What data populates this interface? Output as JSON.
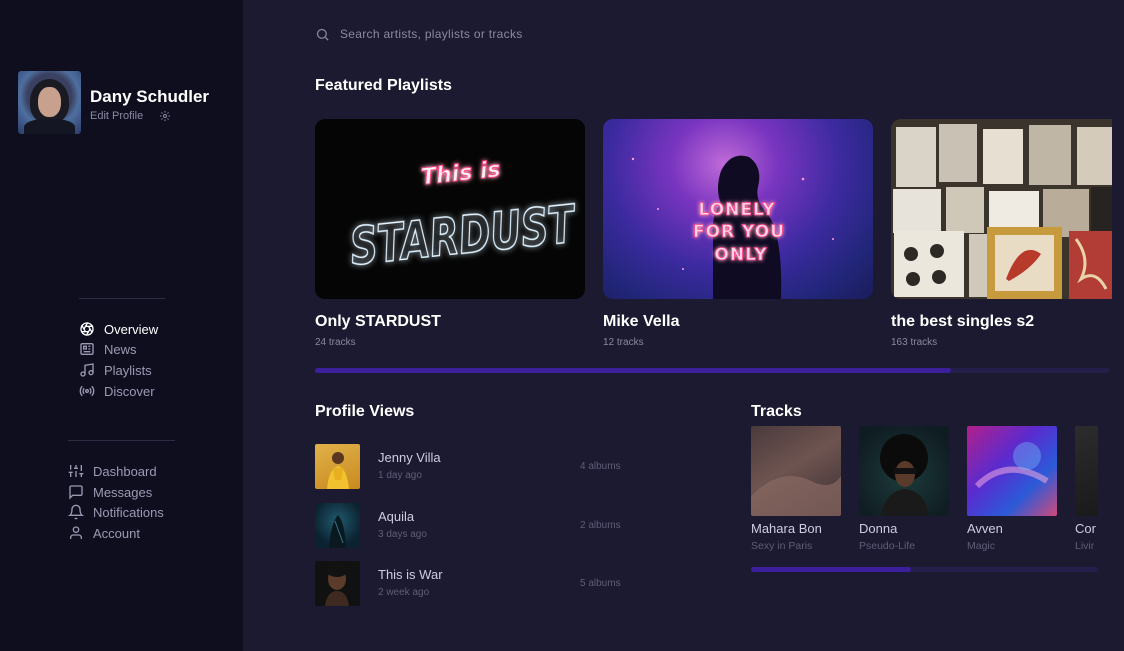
{
  "profile": {
    "name": "Dany Schudler",
    "edit_label": "Edit Profile"
  },
  "nav_primary": [
    {
      "label": "Overview",
      "icon": "aperture-icon",
      "active": true
    },
    {
      "label": "News",
      "icon": "newspaper-icon"
    },
    {
      "label": "Playlists",
      "icon": "music-note-icon"
    },
    {
      "label": "Discover",
      "icon": "radio-icon"
    }
  ],
  "nav_secondary": [
    {
      "label": "Dashboard",
      "icon": "sliders-icon"
    },
    {
      "label": "Messages",
      "icon": "chat-icon"
    },
    {
      "label": "Notifications",
      "icon": "bell-icon"
    },
    {
      "label": "Account",
      "icon": "user-icon"
    }
  ],
  "search": {
    "placeholder": "Search artists, playlists or tracks"
  },
  "featured": {
    "title": "Featured Playlists",
    "playlists": [
      {
        "title": "Only STARDUST",
        "tracks": "24 tracks",
        "cover_text_top": "This is",
        "cover_text_main": "STARDUST"
      },
      {
        "title": "Mike Vella",
        "tracks": "12 tracks",
        "cover_text_lines": [
          "LONELY",
          "FOR YOU",
          "ONLY"
        ]
      },
      {
        "title": "the best singles s2",
        "tracks": "163 tracks"
      }
    ],
    "scroll_progress": 0.8
  },
  "profile_views": {
    "title": "Profile Views",
    "items": [
      {
        "name": "Jenny Villa",
        "time": "1 day ago",
        "albums": "4 albums"
      },
      {
        "name": "Aquila",
        "time": "3 days ago",
        "albums": "2 albums"
      },
      {
        "name": "This is War",
        "time": "2 week ago",
        "albums": "5 albums"
      }
    ]
  },
  "tracks": {
    "title": "Tracks",
    "items": [
      {
        "title": "Mahara Bon",
        "subtitle": "Sexy in Paris"
      },
      {
        "title": "Donna",
        "subtitle": "Pseudo-Life"
      },
      {
        "title": "Avven",
        "subtitle": "Magic"
      },
      {
        "title": "Cor",
        "subtitle": "Livir"
      }
    ],
    "scroll_progress": 0.46
  },
  "colors": {
    "accent": "#3b1f9c",
    "sidebar_bg": "#0f0e1f",
    "main_bg": "#1c1a30",
    "muted_text": "#8b89a3"
  }
}
